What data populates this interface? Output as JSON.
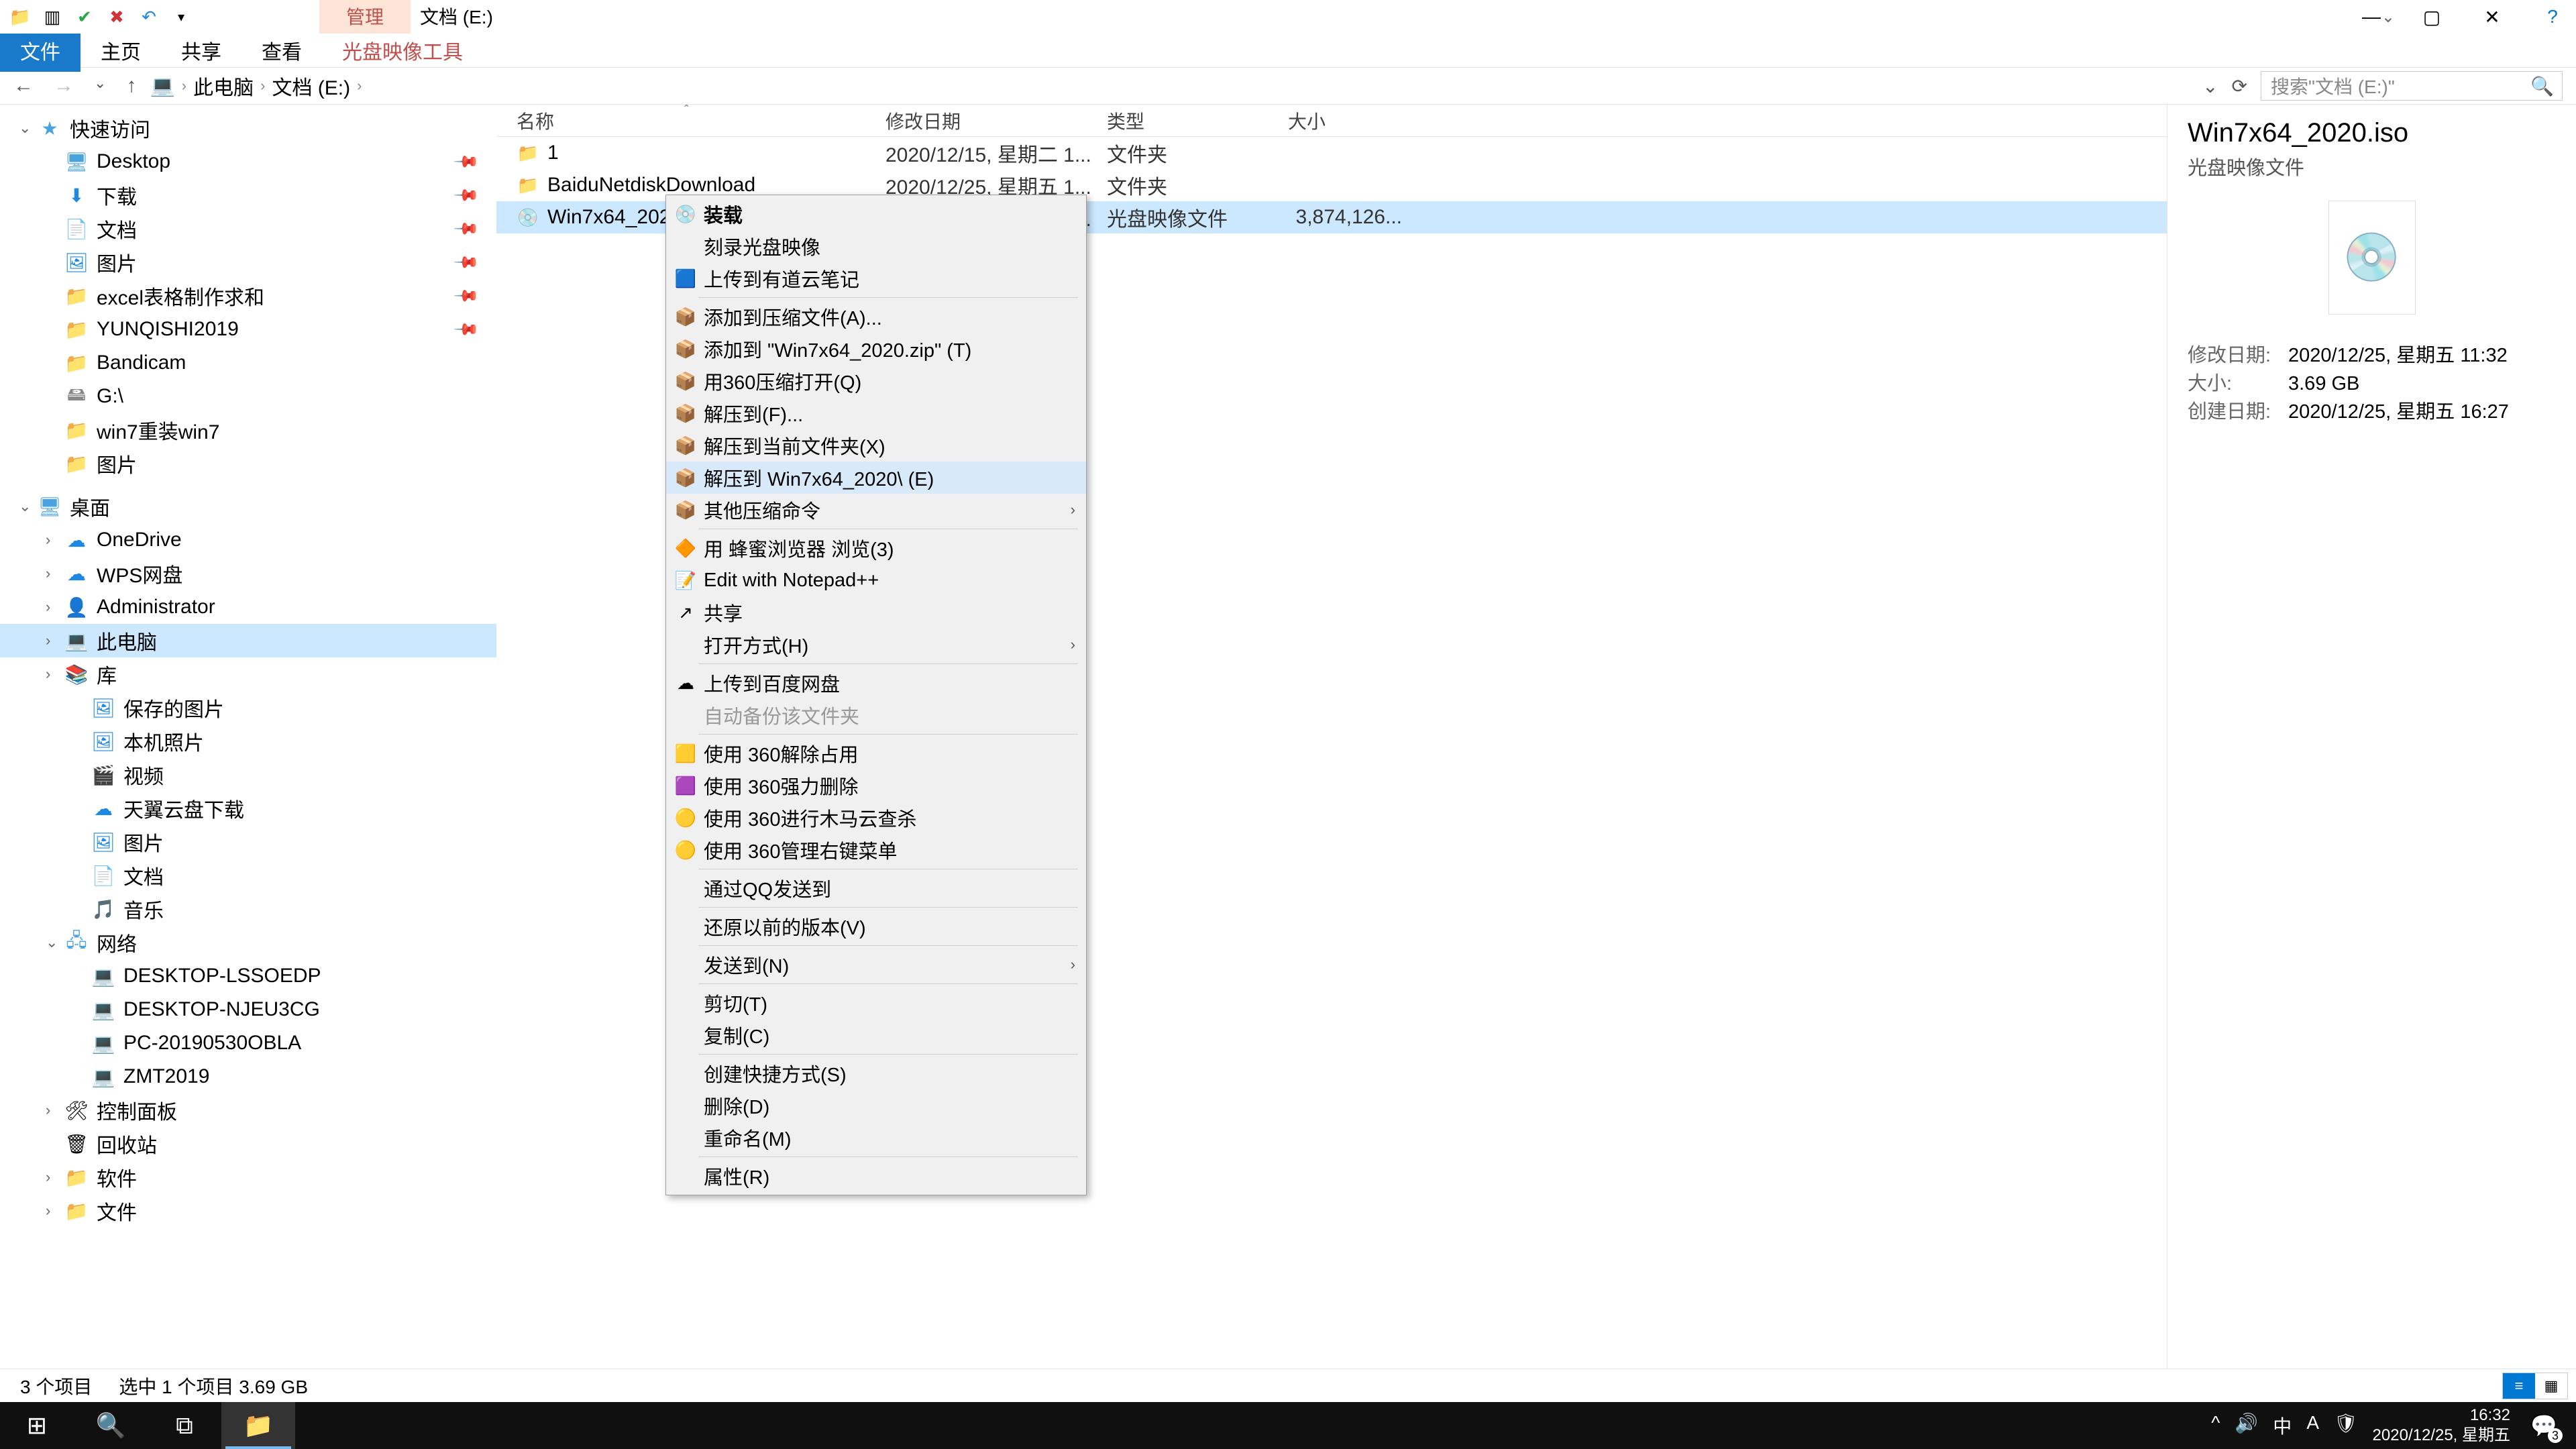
{
  "title_tabs": {
    "manage": "管理",
    "location": "文档 (E:)"
  },
  "ribbon": {
    "file": "文件",
    "home": "主页",
    "share": "共享",
    "view": "查看",
    "disc_tool": "光盘映像工具"
  },
  "breadcrumb": {
    "pc": "此电脑",
    "drive": "文档 (E:)"
  },
  "search_placeholder": "搜索\"文档 (E:)\"",
  "columns": {
    "name": "名称",
    "date": "修改日期",
    "type": "类型",
    "size": "大小"
  },
  "nav": {
    "quick": "快速访问",
    "quick_items": [
      {
        "icon": "🖥",
        "label": "Desktop",
        "pinned": true,
        "cls": "ico-desktop"
      },
      {
        "icon": "⬇",
        "label": "下载",
        "pinned": true,
        "cls": "ico-blue"
      },
      {
        "icon": "📄",
        "label": "文档",
        "pinned": true,
        "cls": "ico-blue"
      },
      {
        "icon": "🖼",
        "label": "图片",
        "pinned": true,
        "cls": "ico-blue"
      },
      {
        "icon": "📁",
        "label": "excel表格制作求和",
        "pinned": true,
        "cls": "ico-folder"
      },
      {
        "icon": "📁",
        "label": "YUNQISHI2019",
        "pinned": true,
        "cls": "ico-folder"
      },
      {
        "icon": "📁",
        "label": "Bandicam",
        "pinned": false,
        "cls": "ico-folder"
      },
      {
        "icon": "🖴",
        "label": "G:\\",
        "pinned": false,
        "cls": "ico-disk"
      },
      {
        "icon": "📁",
        "label": "win7重装win7",
        "pinned": false,
        "cls": "ico-folder"
      },
      {
        "icon": "📁",
        "label": "图片",
        "pinned": false,
        "cls": "ico-folder"
      }
    ],
    "desktop": "桌面",
    "desktop_items": [
      {
        "icon": "☁",
        "label": "OneDrive",
        "cls": "ico-blue"
      },
      {
        "icon": "☁",
        "label": "WPS网盘",
        "cls": "ico-blue"
      },
      {
        "icon": "👤",
        "label": "Administrator",
        "cls": ""
      },
      {
        "icon": "💻",
        "label": "此电脑",
        "cls": "ico-monitor",
        "selected": true
      },
      {
        "icon": "📚",
        "label": "库",
        "cls": "ico-blue"
      }
    ],
    "lib_items": [
      {
        "icon": "🖼",
        "label": "保存的图片"
      },
      {
        "icon": "🖼",
        "label": "本机照片"
      },
      {
        "icon": "🎬",
        "label": "视频"
      },
      {
        "icon": "☁",
        "label": "天翼云盘下载"
      },
      {
        "icon": "🖼",
        "label": "图片"
      },
      {
        "icon": "📄",
        "label": "文档"
      },
      {
        "icon": "🎵",
        "label": "音乐"
      }
    ],
    "network": "网络",
    "net_items": [
      {
        "label": "DESKTOP-LSSOEDP"
      },
      {
        "label": "DESKTOP-NJEU3CG"
      },
      {
        "label": "PC-20190530OBLA"
      },
      {
        "label": "ZMT2019"
      }
    ],
    "cp": "控制面板",
    "recycle": "回收站",
    "soft": "软件",
    "files": "文件"
  },
  "rows": [
    {
      "icon": "📁",
      "name": "1",
      "date": "2020/12/15, 星期二 1...",
      "type": "文件夹",
      "size": ""
    },
    {
      "icon": "📁",
      "name": "BaiduNetdiskDownload",
      "date": "2020/12/25, 星期五 1...",
      "type": "文件夹",
      "size": ""
    },
    {
      "icon": "💿",
      "name": "Win7x64_2020.iso",
      "date": "2020/12/25, 星期五 1...",
      "type": "光盘映像文件",
      "size": "3,874,126...",
      "selected": true
    }
  ],
  "context": [
    {
      "type": "item",
      "label": "装载",
      "bold": true,
      "icon": "💿"
    },
    {
      "type": "item",
      "label": "刻录光盘映像"
    },
    {
      "type": "item",
      "label": "上传到有道云笔记",
      "icon": "🟦"
    },
    {
      "type": "sep"
    },
    {
      "type": "item",
      "label": "添加到压缩文件(A)...",
      "icon": "📦"
    },
    {
      "type": "item",
      "label": "添加到 \"Win7x64_2020.zip\" (T)",
      "icon": "📦"
    },
    {
      "type": "item",
      "label": "用360压缩打开(Q)",
      "icon": "📦"
    },
    {
      "type": "item",
      "label": "解压到(F)...",
      "icon": "📦"
    },
    {
      "type": "item",
      "label": "解压到当前文件夹(X)",
      "icon": "📦"
    },
    {
      "type": "item",
      "label": "解压到 Win7x64_2020\\ (E)",
      "icon": "📦",
      "hovered": true
    },
    {
      "type": "item",
      "label": "其他压缩命令",
      "icon": "📦",
      "submenu": true
    },
    {
      "type": "sep"
    },
    {
      "type": "item",
      "label": "用 蜂蜜浏览器 浏览(3)",
      "icon": "🔶"
    },
    {
      "type": "item",
      "label": "Edit with Notepad++",
      "icon": "📝"
    },
    {
      "type": "item",
      "label": "共享",
      "icon": "↗"
    },
    {
      "type": "item",
      "label": "打开方式(H)",
      "submenu": true
    },
    {
      "type": "sep"
    },
    {
      "type": "item",
      "label": "上传到百度网盘",
      "icon": "☁"
    },
    {
      "type": "item",
      "label": "自动备份该文件夹",
      "disabled": true
    },
    {
      "type": "sep"
    },
    {
      "type": "item",
      "label": "使用 360解除占用",
      "icon": "🟨"
    },
    {
      "type": "item",
      "label": "使用 360强力删除",
      "icon": "🟪"
    },
    {
      "type": "item",
      "label": "使用 360进行木马云查杀",
      "icon": "🟡"
    },
    {
      "type": "item",
      "label": "使用 360管理右键菜单",
      "icon": "🟡"
    },
    {
      "type": "sep"
    },
    {
      "type": "item",
      "label": "通过QQ发送到"
    },
    {
      "type": "sep"
    },
    {
      "type": "item",
      "label": "还原以前的版本(V)"
    },
    {
      "type": "sep"
    },
    {
      "type": "item",
      "label": "发送到(N)",
      "submenu": true
    },
    {
      "type": "sep"
    },
    {
      "type": "item",
      "label": "剪切(T)"
    },
    {
      "type": "item",
      "label": "复制(C)"
    },
    {
      "type": "sep"
    },
    {
      "type": "item",
      "label": "创建快捷方式(S)"
    },
    {
      "type": "item",
      "label": "删除(D)"
    },
    {
      "type": "item",
      "label": "重命名(M)"
    },
    {
      "type": "sep"
    },
    {
      "type": "item",
      "label": "属性(R)"
    }
  ],
  "details": {
    "title": "Win7x64_2020.iso",
    "subtitle": "光盘映像文件",
    "meta": [
      {
        "label": "修改日期:",
        "value": "2020/12/25, 星期五 11:32"
      },
      {
        "label": "大小:",
        "value": "3.69 GB"
      },
      {
        "label": "创建日期:",
        "value": "2020/12/25, 星期五 16:27"
      }
    ]
  },
  "status": {
    "count": "3 个项目",
    "selected": "选中 1 个项目  3.69 GB"
  },
  "taskbar": {
    "ime1": "中",
    "ime2": "A",
    "time": "16:32",
    "date": "2020/12/25, 星期五",
    "badge": "3"
  }
}
